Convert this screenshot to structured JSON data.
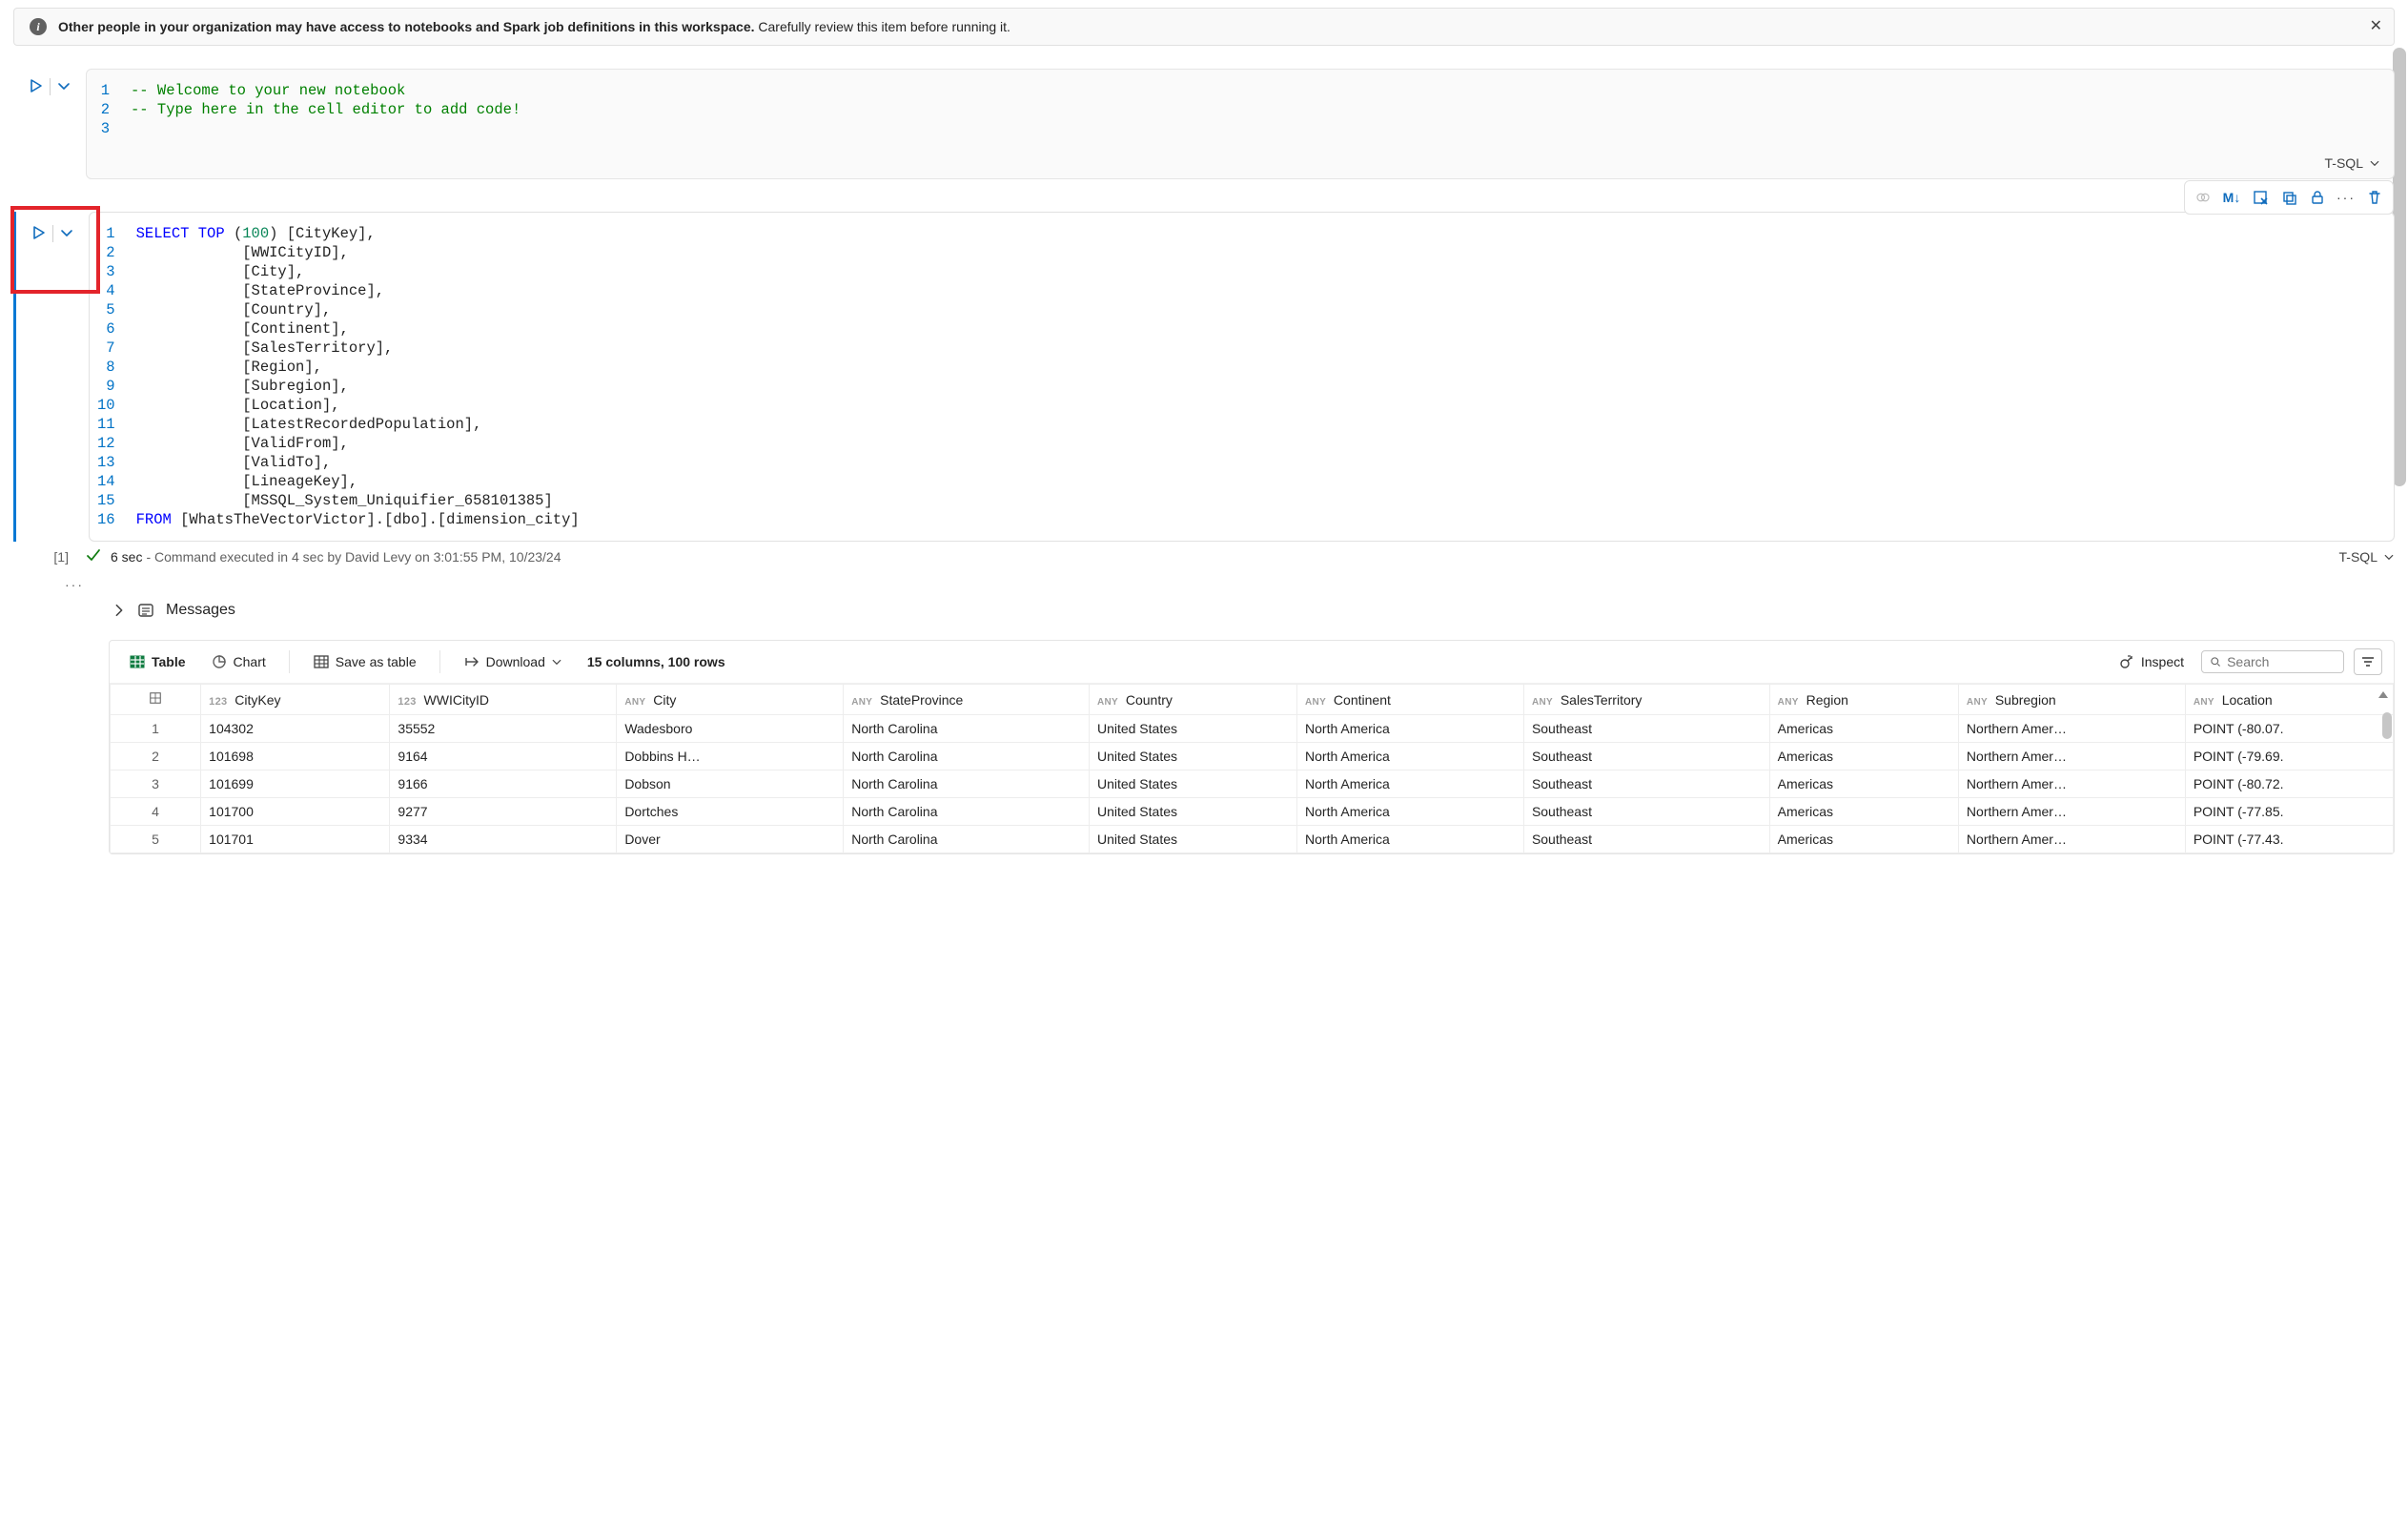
{
  "banner": {
    "bold": "Other people in your organization may have access to notebooks and Spark job definitions in this workspace.",
    "rest": " Carefully review this item before running it."
  },
  "cell1": {
    "line_numbers": [
      "1",
      "2",
      "3"
    ],
    "lines": [
      "-- Welcome to your new notebook",
      "-- Type here in the cell editor to add code!",
      ""
    ],
    "language": "T-SQL"
  },
  "cell2": {
    "line_numbers": [
      "1",
      "2",
      "3",
      "4",
      "5",
      "6",
      "7",
      "8",
      "9",
      "10",
      "11",
      "12",
      "13",
      "14",
      "15",
      "16"
    ],
    "tokens": [
      [
        [
          "SELECT",
          "kw"
        ],
        [
          " ",
          ""
        ],
        [
          "TOP",
          "kw"
        ],
        [
          " (",
          ""
        ],
        [
          "100",
          "num"
        ],
        [
          ") [CityKey],",
          ""
        ]
      ],
      [
        [
          "            [WWICityID],",
          ""
        ]
      ],
      [
        [
          "            [City],",
          ""
        ]
      ],
      [
        [
          "            [StateProvince],",
          ""
        ]
      ],
      [
        [
          "            [Country],",
          ""
        ]
      ],
      [
        [
          "            [Continent],",
          ""
        ]
      ],
      [
        [
          "            [SalesTerritory],",
          ""
        ]
      ],
      [
        [
          "            [Region],",
          ""
        ]
      ],
      [
        [
          "            [Subregion],",
          ""
        ]
      ],
      [
        [
          "            [Location],",
          ""
        ]
      ],
      [
        [
          "            [LatestRecordedPopulation],",
          ""
        ]
      ],
      [
        [
          "            [ValidFrom],",
          ""
        ]
      ],
      [
        [
          "            [ValidTo],",
          ""
        ]
      ],
      [
        [
          "            [LineageKey],",
          ""
        ]
      ],
      [
        [
          "            [MSSQL_System_Uniquifier_658101385]",
          ""
        ]
      ],
      [
        [
          "FROM",
          "kw"
        ],
        [
          " [WhatsTheVectorVictor].[dbo].[dimension_city]",
          ""
        ]
      ]
    ],
    "language": "T-SQL",
    "exec_index": "[1]",
    "status_duration": "6 sec",
    "status_msg": " - Command executed in 4 sec by David Levy on 3:01:55 PM, 10/23/24"
  },
  "toolbar_md": "M↓",
  "messages_label": "Messages",
  "results_toolbar": {
    "table": "Table",
    "chart": "Chart",
    "save": "Save as table",
    "download": "Download",
    "summary": "15 columns, 100 rows",
    "inspect": "Inspect",
    "search_placeholder": "Search"
  },
  "results": {
    "columns": [
      {
        "type": "123",
        "label": "CityKey"
      },
      {
        "type": "123",
        "label": "WWICityID"
      },
      {
        "type": "ANY",
        "label": "City"
      },
      {
        "type": "ANY",
        "label": "StateProvince"
      },
      {
        "type": "ANY",
        "label": "Country"
      },
      {
        "type": "ANY",
        "label": "Continent"
      },
      {
        "type": "ANY",
        "label": "SalesTerritory"
      },
      {
        "type": "ANY",
        "label": "Region"
      },
      {
        "type": "ANY",
        "label": "Subregion"
      },
      {
        "type": "ANY",
        "label": "Location"
      }
    ],
    "rows": [
      [
        "1",
        "104302",
        "35552",
        "Wadesboro",
        "North Carolina",
        "United States",
        "North America",
        "Southeast",
        "Americas",
        "Northern Amer…",
        "POINT (-80.07."
      ],
      [
        "2",
        "101698",
        "9164",
        "Dobbins H…",
        "North Carolina",
        "United States",
        "North America",
        "Southeast",
        "Americas",
        "Northern Amer…",
        "POINT (-79.69."
      ],
      [
        "3",
        "101699",
        "9166",
        "Dobson",
        "North Carolina",
        "United States",
        "North America",
        "Southeast",
        "Americas",
        "Northern Amer…",
        "POINT (-80.72."
      ],
      [
        "4",
        "101700",
        "9277",
        "Dortches",
        "North Carolina",
        "United States",
        "North America",
        "Southeast",
        "Americas",
        "Northern Amer…",
        "POINT (-77.85."
      ],
      [
        "5",
        "101701",
        "9334",
        "Dover",
        "North Carolina",
        "United States",
        "North America",
        "Southeast",
        "Americas",
        "Northern Amer…",
        "POINT (-77.43."
      ]
    ]
  }
}
